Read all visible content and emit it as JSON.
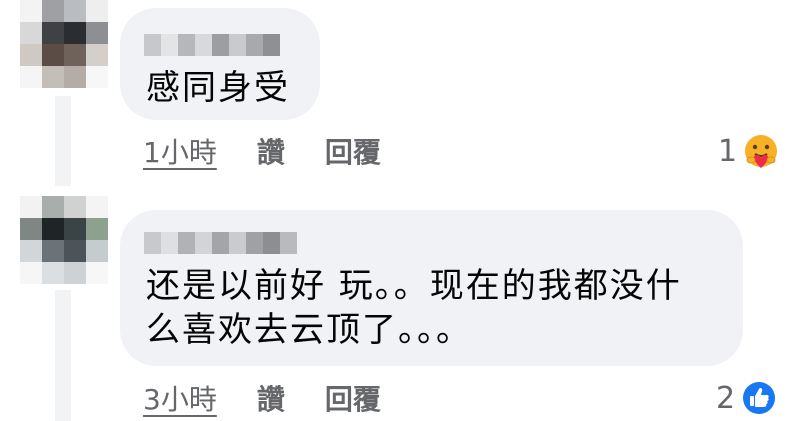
{
  "comments": [
    {
      "text_lines": [
        "感同身受"
      ],
      "time": "1小時",
      "like_label": "讚",
      "reply_label": "回覆",
      "reaction_count": "1",
      "reaction_icon": "care-emoji-icon"
    },
    {
      "text_lines": [
        "还是以前好 玩。。现在的我都没什",
        "么喜欢去云顶了。。。"
      ],
      "time": "3小時",
      "like_label": "讚",
      "reply_label": "回覆",
      "reaction_count": "2",
      "reaction_icon": "like-thumb-icon"
    }
  ],
  "colors": {
    "bubble": "#f0f2f5",
    "meta_text": "#65676b",
    "like_blue": "#1877f2",
    "care_yellow": "#f7b125"
  }
}
